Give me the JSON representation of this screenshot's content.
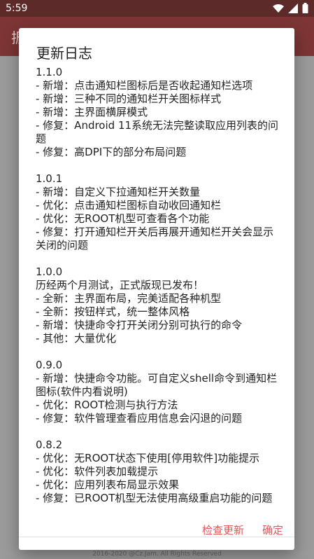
{
  "status_bar": {
    "time": "5:59"
  },
  "app_bar": {
    "title_partial": "振"
  },
  "footer": {
    "text": "2016-2020 @Cz.Jam. All Rights Reserved"
  },
  "dialog": {
    "title": "更新日志",
    "releases": [
      {
        "version": "1.1.0",
        "lines": [
          "- 新增：点击通知栏图标后是否收起通知栏选项",
          "- 新增：三种不同的通知栏开关图标样式",
          "- 新增：主界面横屏模式",
          "- 修复：Android 11系统无法完整读取应用列表的问题",
          "- 修复：高DPI下的部分布局问题"
        ]
      },
      {
        "version": "1.0.1",
        "lines": [
          "- 新增：自定义下拉通知栏开关数量",
          "- 优化：点击通知栏图标自动收回通知栏",
          "- 优化：无ROOT机型可查看各个功能",
          "- 修复：打开通知栏开关后再展开通知栏开关会显示关闭的问题"
        ]
      },
      {
        "version": "1.0.0",
        "lines": [
          "历经两个月测试，正式版现已发布！",
          "- 全新：主界面布局，完美适配各种机型",
          "- 全新：按钮样式，统一整体风格",
          "- 新增：快捷命令打开关闭分别可执行的命令",
          "- 其他：大量优化"
        ]
      },
      {
        "version": "0.9.0",
        "lines": [
          "- 新增：快捷命令功能。可自定义shell命令到通知栏图标(软件内看说明)",
          "- 优化：ROOT检测与执行方法",
          "- 修复：软件管理查看应用信息会闪退的问题"
        ]
      },
      {
        "version": "0.8.2",
        "lines": [
          "- 优化：无ROOT状态下使用[停用软件]功能提示",
          "- 优化：软件列表加载提示",
          "- 优化：应用列表布局显示效果",
          "- 修复：已ROOT机型无法使用高级重启功能的问题"
        ]
      }
    ],
    "check_update_label": "检查更新",
    "confirm_label": "确定"
  },
  "colors": {
    "accent": "#e05757",
    "app_bar": "#7d3535",
    "status_bar": "#5d2a2a"
  }
}
